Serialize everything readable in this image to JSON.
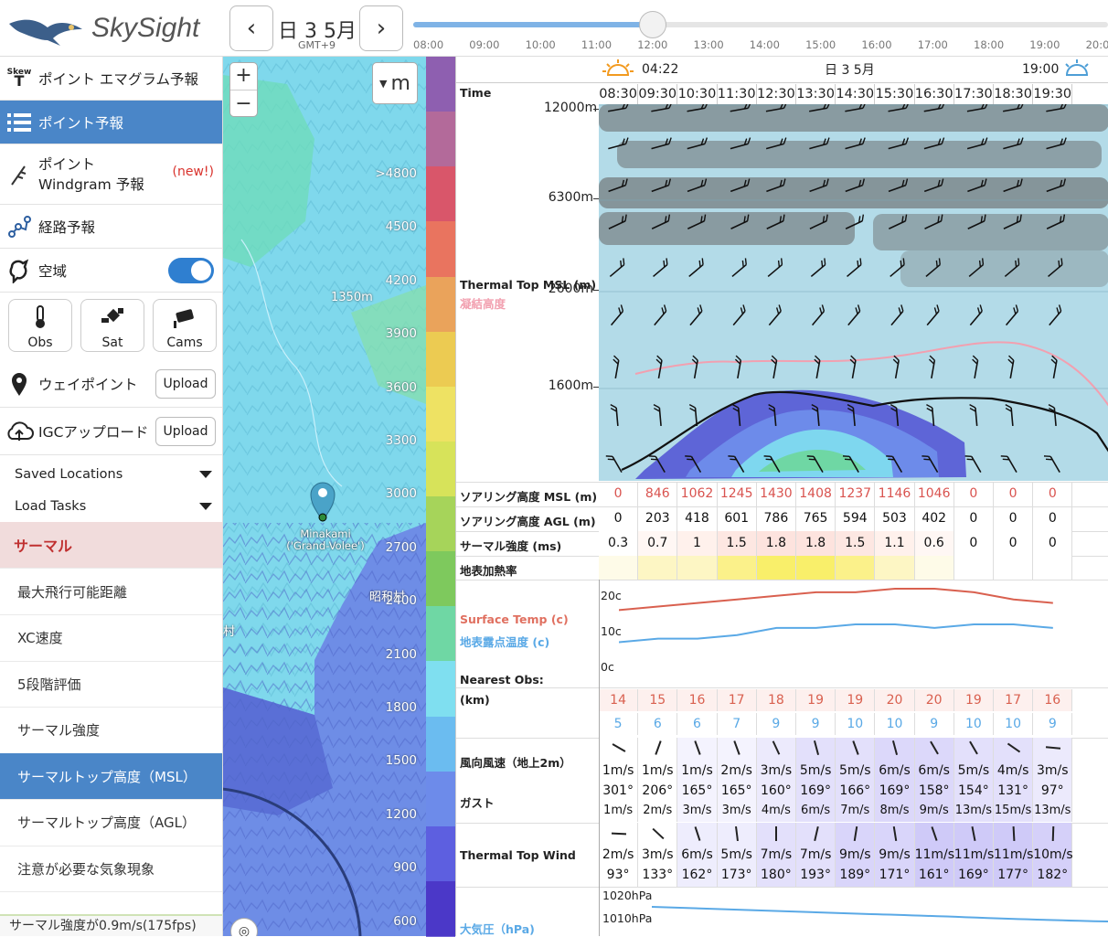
{
  "app": {
    "name": "SkySight"
  },
  "header": {
    "date": "日 3 5月",
    "tz": "GMT+9",
    "prev_icon": "chevron-left-icon",
    "next_icon": "chevron-right-icon",
    "timeline": [
      "08:00",
      "09:00",
      "10:00",
      "11:00",
      "12:00",
      "13:00",
      "14:00",
      "15:00",
      "16:00",
      "17:00",
      "18:00",
      "19:00",
      "20:00"
    ],
    "timeline_position_fraction": 0.345
  },
  "sidebar": {
    "items": [
      {
        "label": "ポイント エマグラム予報",
        "icon": "skew-t-icon",
        "icon_text": "Skew T"
      },
      {
        "label": "ポイント予報",
        "icon": "list-icon"
      },
      {
        "label": "ポイント Windgram 予報",
        "badge": "(new!)",
        "icon": "windgram-icon"
      },
      {
        "label": "経路予報",
        "icon": "route-icon"
      },
      {
        "label": "空域",
        "icon": "airspace-icon",
        "toggle": true
      }
    ],
    "tiles": [
      {
        "label": "Obs",
        "icon": "thermometer-icon"
      },
      {
        "label": "Sat",
        "icon": "satellite-icon"
      },
      {
        "label": "Cams",
        "icon": "camera-icon"
      }
    ],
    "waypoint": {
      "label": "ウェイポイント",
      "button": "Upload"
    },
    "igc": {
      "label": "IGCアップロード",
      "button": "Upload"
    },
    "saved_locations": "Saved Locations",
    "load_tasks": "Load Tasks",
    "section": "サーマル",
    "layers": [
      "最大飛行可能距離",
      "XC速度",
      "5段階評価",
      "サーマル強度",
      "サーマルトップ高度（MSL）",
      "サーマルトップ高度（AGL）",
      "注意が必要な気象現象"
    ],
    "selected_layer": "サーマルトップ高度（MSL）",
    "status": "サーマル強度が0.9m/s(175fps)"
  },
  "map": {
    "zoom_in": "+",
    "zoom_out": "−",
    "unit": "m",
    "pin_label_1": "Minakami",
    "pin_label_2": "('Grand-Volee')",
    "labels": {
      "elev": "1350m",
      "village": "昭和村",
      "left": "村"
    },
    "scale": [
      ">4800",
      "4500",
      "4200",
      "3900",
      "3600",
      "3300",
      "3000",
      "2700",
      "2400",
      "2100",
      "1800",
      "1500",
      "1200",
      "900",
      "600"
    ]
  },
  "legend_colors": [
    "#8e5fb0",
    "#b36a9a",
    "#d9566a",
    "#e9745f",
    "#eaa35b",
    "#eccb52",
    "#eee263",
    "#d7e35a",
    "#a6d45a",
    "#7ec95d",
    "#6fd7a4",
    "#7fdff0",
    "#6bbcf0",
    "#6d8bea",
    "#5d5fe0",
    "#4b38c8"
  ],
  "forecast": {
    "sunrise": "04:22",
    "sunset": "19:00",
    "date": "日 3 5月",
    "time_label": "Time",
    "times": [
      "08:30",
      "09:30",
      "10:30",
      "11:30",
      "12:30",
      "13:30",
      "14:30",
      "15:30",
      "16:30",
      "17:30",
      "18:30",
      "19:30"
    ],
    "altitudes": [
      "12000m",
      "6300m",
      "2600m",
      "1600m"
    ],
    "thermal_top_label": "Thermal Top MSL (m)",
    "freezing_label": "凝結高度",
    "rows": {
      "soaring_msl": {
        "label": "ソアリング高度 MSL (m)",
        "values": [
          "0",
          "846",
          "1062",
          "1245",
          "1430",
          "1408",
          "1237",
          "1146",
          "1046",
          "0",
          "0",
          "0"
        ]
      },
      "soaring_agl": {
        "label": "ソアリング高度 AGL (m)",
        "values": [
          "0",
          "203",
          "418",
          "601",
          "786",
          "765",
          "594",
          "503",
          "402",
          "0",
          "0",
          "0"
        ]
      },
      "thermal_strength": {
        "label": "サーマル強度 (ms)",
        "values": [
          "0.3",
          "0.7",
          "1",
          "1.5",
          "1.8",
          "1.8",
          "1.5",
          "1.1",
          "0.6",
          "0",
          "0",
          "0"
        ]
      },
      "surface_heating": {
        "label": "地表加熱率"
      },
      "surface_temp_label": "Surface Temp (c)",
      "dewpoint_label": "地表露点温度 (c)",
      "nearest_obs_label": "Nearest Obs:",
      "km_label": "(km)",
      "temp_axis": [
        "20c",
        "10c",
        "0c"
      ],
      "temps": [
        "14",
        "15",
        "16",
        "17",
        "18",
        "19",
        "19",
        "20",
        "20",
        "19",
        "17",
        "16"
      ],
      "dewpoints": [
        "5",
        "6",
        "6",
        "7",
        "9",
        "9",
        "10",
        "10",
        "9",
        "10",
        "10",
        "9"
      ],
      "wind_label": "風向風速（地上2m）",
      "gust_label": "ガスト",
      "wind_speed": [
        "1m/s",
        "1m/s",
        "1m/s",
        "2m/s",
        "3m/s",
        "5m/s",
        "5m/s",
        "6m/s",
        "6m/s",
        "5m/s",
        "4m/s",
        "3m/s"
      ],
      "wind_dir": [
        "301°",
        "206°",
        "165°",
        "165°",
        "160°",
        "169°",
        "166°",
        "169°",
        "158°",
        "154°",
        "131°",
        "97°"
      ],
      "gust": [
        "1m/s",
        "2m/s",
        "3m/s",
        "3m/s",
        "4m/s",
        "6m/s",
        "7m/s",
        "8m/s",
        "9m/s",
        "13m/s",
        "15m/s",
        "13m/s"
      ],
      "ttw_label": "Thermal Top Wind",
      "ttw_speed": [
        "2m/s",
        "3m/s",
        "6m/s",
        "5m/s",
        "7m/s",
        "7m/s",
        "9m/s",
        "9m/s",
        "11m/s",
        "11m/s",
        "11m/s",
        "10m/s"
      ],
      "ttw_dir": [
        "93°",
        "133°",
        "162°",
        "173°",
        "180°",
        "193°",
        "189°",
        "171°",
        "161°",
        "169°",
        "177°",
        "182°"
      ],
      "pressure_label": "大気圧（hPa)",
      "pressure_axis": [
        "1020hPa",
        "1010hPa"
      ]
    }
  }
}
